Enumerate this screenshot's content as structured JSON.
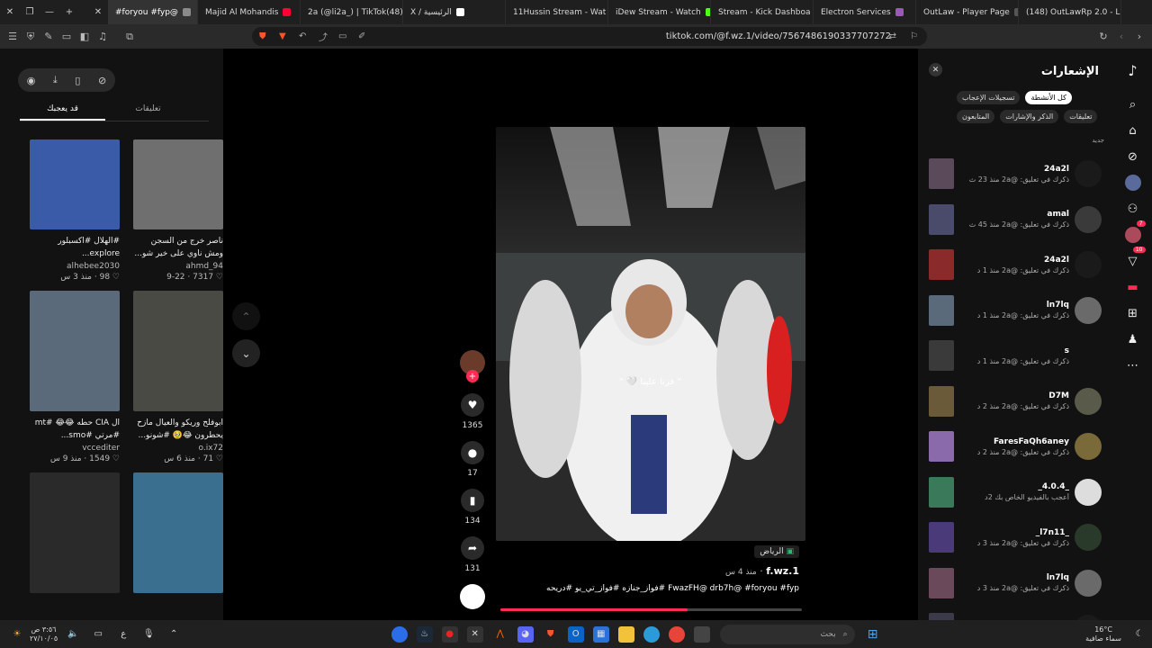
{
  "browser": {
    "tabs": [
      {
        "label": "#foryou #fyp@",
        "color": "#8a8a8a",
        "active": true
      },
      {
        "label": "Majid Al Mohandis",
        "color": "#ff0033",
        "active": false
      },
      {
        "label": "2a (@li2a_) | TikTok(48)",
        "color": "#ffffff",
        "active": false
      },
      {
        "label": "X / الرئيسية",
        "color": "#ffffff",
        "active": false
      },
      {
        "label": "11Hussin Stream - Wat",
        "color": "#53fc18",
        "active": false
      },
      {
        "label": "iDew Stream - Watch",
        "color": "#53fc18",
        "active": false
      },
      {
        "label": "Stream - Kick Dashboa",
        "color": "#53fc18",
        "active": false
      },
      {
        "label": "Electron Services",
        "color": "#9b59b6",
        "active": false
      },
      {
        "label": "OutLaw - Player Page",
        "color": "#555555",
        "active": false
      },
      {
        "label": "(148) OutLawRp 2.0 - L",
        "color": "#5865f2",
        "active": false
      }
    ],
    "url": "tiktok.com/@f.wz.1/video/7567486190337707272"
  },
  "left_panel": {
    "tab_for_you": "قد يعجبك",
    "tab_comments": "تعليقات",
    "videos": [
      {
        "caption": "ناصر خرج من السجن ومش ناوي على خير شو...",
        "author": "ahmd_94",
        "likes": "7317",
        "age": "9-22",
        "thumb_color": "#6f6f6f",
        "tall": false
      },
      {
        "caption": "#الهلال #اكسبلور explore...",
        "author": "alhebee2030",
        "likes": "98",
        "age": "منذ 3 س",
        "thumb_color": "#3a5ca8",
        "tall": false
      },
      {
        "caption": "ابوفلح وريكو والعيال مازح يحطرون 😂🥹 #شونو...",
        "author": "o.ix72",
        "likes": "71",
        "age": "منذ 6 س",
        "thumb_color": "#4a4a44",
        "tall": true
      },
      {
        "caption": "ال CIA حطه 😂😂 #mt #مرتي #smo...",
        "author": "vccediter",
        "likes": "1549",
        "age": "منذ 9 س",
        "thumb_color": "#5a6a7a",
        "tall": true
      },
      {
        "caption": "",
        "author": "",
        "likes": "",
        "age": "",
        "thumb_color": "#3b6f8f",
        "tall": true
      },
      {
        "caption": "",
        "author": "",
        "likes": "",
        "age": "",
        "thumb_color": "#2a2a2a",
        "tall": true
      }
    ]
  },
  "video": {
    "overlay_caption": "\" فزنا علينا 🤍 \"",
    "likes": "1365",
    "comments": "17",
    "saves": "134",
    "shares": "131",
    "location": "الرياض",
    "username": "f.wz.1",
    "age": "منذ 4 س",
    "description": "FwazFH@ drb7h@ #foryou #fyp #فواز_جنازه #فواز_تي_يو #دريحه",
    "progress": 0.62
  },
  "notifications": {
    "title": "الإشعارات",
    "filters": [
      "كل الأنشطة",
      "تسجيلات الإعجاب",
      "تعليقات",
      "الذكر والإشارات",
      "المتابعون"
    ],
    "active_filter": 0,
    "section": "جديد",
    "items": [
      {
        "user": "24a2l",
        "message": "ذكرك في تعليق: @2a",
        "age": "منذ 23 ث",
        "avatar": "#1a1a1a",
        "thumb": "#5a4a5a"
      },
      {
        "user": "amal",
        "message": "ذكرك في تعليق: @2a",
        "age": "منذ 45 ث",
        "avatar": "#3a3a3a",
        "thumb": "#4a4a6a"
      },
      {
        "user": "24a2l",
        "message": "ذكرك في تعليق: @2a",
        "age": "منذ 1 د",
        "avatar": "#1a1a1a",
        "thumb": "#8a2a2a"
      },
      {
        "user": "ln7lq",
        "message": "ذكرك في تعليق: @2a",
        "age": "منذ 1 د",
        "avatar": "#6a6a6a",
        "thumb": "#5a6a7a"
      },
      {
        "user": "s",
        "message": "ذكرك في تعليق: @2a",
        "age": "منذ 1 د",
        "avatar": "#121212",
        "thumb": "#3a3a3a"
      },
      {
        "user": "D7M",
        "message": "ذكرك في تعليق: @2a",
        "age": "منذ 2 د",
        "avatar": "#5a5a4a",
        "thumb": "#6a5a3a"
      },
      {
        "user": "FaresFaQh6aney",
        "message": "ذكرك في تعليق: @2a",
        "age": "منذ 2 د",
        "avatar": "#7a6a3a",
        "thumb": "#8a6aaa"
      },
      {
        "user": "_4.0.4_",
        "message": "أعجب بالفيديو الخاص بك 2د",
        "age": "",
        "avatar": "#dddddd",
        "thumb": "#3a7a5a"
      },
      {
        "user": "_l7n11_",
        "message": "ذكرك في تعليق: @2a",
        "age": "منذ 3 د",
        "avatar": "#2a3a2a",
        "thumb": "#4a3a7a"
      },
      {
        "user": "ln7lq",
        "message": "ذكرك في تعليق: @2a",
        "age": "منذ 3 د",
        "avatar": "#6a6a6a",
        "thumb": "#6a4a5a"
      },
      {
        "user": "24a2l",
        "message": "",
        "age": "",
        "avatar": "#1a1a1a",
        "thumb": "#3a3a4a"
      }
    ]
  },
  "rail": {
    "inbox_badge": "10",
    "user_badge": "7"
  },
  "taskbar": {
    "search_placeholder": "بحث",
    "time": "٣:٥٦ ص",
    "date": "٢٧/١٠/٠٥",
    "weather_temp": "16°C",
    "weather_desc": "سماء صافية",
    "lang": "ع"
  }
}
